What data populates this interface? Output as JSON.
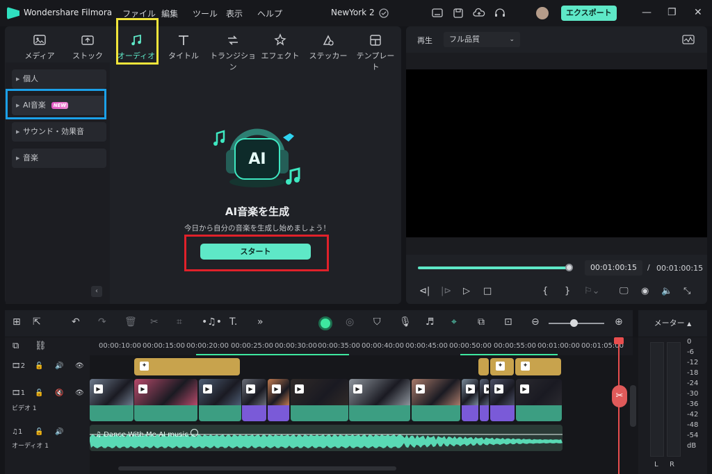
{
  "app": {
    "title": "Wondershare Filmora",
    "menu": [
      "ファイル",
      "編集",
      "ツール",
      "表示",
      "ヘルプ"
    ],
    "project": "NewYork 2",
    "export_label": "エクスポート"
  },
  "tabs": [
    {
      "label": "メディア",
      "icon": "media-icon"
    },
    {
      "label": "ストック",
      "icon": "stock-icon"
    },
    {
      "label": "オーディオ",
      "icon": "audio-note-icon",
      "active": true
    },
    {
      "label": "タイトル",
      "icon": "title-icon"
    },
    {
      "label": "トランジション",
      "icon": "transition-icon"
    },
    {
      "label": "エフェクト",
      "icon": "effect-icon"
    },
    {
      "label": "ステッカー",
      "icon": "sticker-icon"
    },
    {
      "label": "テンプレート",
      "icon": "template-icon"
    }
  ],
  "sidebar": {
    "items": [
      {
        "label": "個人"
      },
      {
        "label": "AI音楽",
        "badge": "NEW"
      },
      {
        "label": "サウンド・効果音"
      },
      {
        "label": "音楽"
      }
    ]
  },
  "ai_music": {
    "heading": "AI音楽を生成",
    "subtitle": "今日から自分の音楽を生成し始めましょう！",
    "start_label": "スタート",
    "icon_text": "AI"
  },
  "preview": {
    "play_label": "再生",
    "quality": "フル品質",
    "current_time": "00:01:00:15",
    "separator": "/",
    "total_time": "00:01:00:15",
    "progress": 1.0
  },
  "timeline": {
    "ruler_labels": [
      "00:00:10:00",
      "00:00:15:00",
      "00:00:20:00",
      "00:00:25:00",
      "00:00:30:00",
      "00:00:35:00",
      "00:00:40:00",
      "00:00:45:00",
      "00:00:50:00",
      "00:00:55:00",
      "00:01:00:00",
      "00:01:05:00"
    ],
    "tracks": {
      "video2_num": "2",
      "video1_num": "1",
      "video1_name": "ビデオ 1",
      "audio1_num": "1",
      "audio1_name": "オーディオ 1"
    },
    "audio_clip_name": "Dance With Me-AI music"
  },
  "meter": {
    "title": "メーター",
    "scale": [
      "0",
      "-6",
      "-12",
      "-18",
      "-24",
      "-30",
      "-36",
      "-42",
      "-48",
      "-54",
      "dB"
    ],
    "left": "L",
    "right": "R"
  },
  "colors": {
    "accent": "#5ee8c7",
    "gold_clip": "#c8a34d",
    "purple_clip": "#7a5ad8",
    "green_clip": "#3c9e82",
    "playhead": "#e84e4e",
    "highlight_yellow": "#f1e53b",
    "highlight_blue": "#1ba0e8",
    "highlight_red": "#e0212a"
  }
}
